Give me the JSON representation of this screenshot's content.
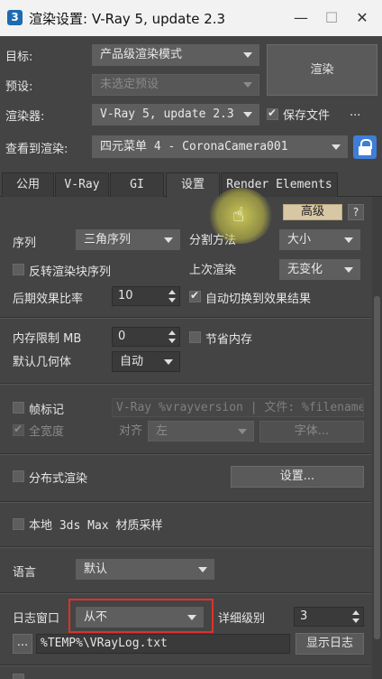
{
  "window": {
    "title": "渲染设置: V-Ray 5, update 2.3",
    "app_icon_glyph": "3"
  },
  "top": {
    "target_label": "目标:",
    "target_value": "产品级渲染模式",
    "preset_label": "预设:",
    "preset_value": "未选定预设",
    "renderer_label": "渲染器:",
    "renderer_value": "V-Ray 5, update 2.3",
    "save_file_label": "保存文件",
    "save_file_checked": true,
    "more_label": "...",
    "render_button": "渲染",
    "view_label": "查看到渲染:",
    "view_value": "四元菜单 4 - CoronaCamera001"
  },
  "tabs": [
    {
      "label": "公用",
      "active": false
    },
    {
      "label": "V-Ray",
      "active": false
    },
    {
      "label": "GI",
      "active": false
    },
    {
      "label": "设置",
      "active": true
    },
    {
      "label": "Render Elements",
      "active": false
    }
  ],
  "panel": {
    "advanced_button": "高级",
    "help_button": "?",
    "sequence_label": "序列",
    "sequence_value": "三角序列",
    "division_label": "分割方法",
    "division_value": "大小",
    "reverse_label": "反转渲染块序列",
    "reverse_checked": false,
    "last_render_label": "上次渲染",
    "last_render_value": "无变化",
    "post_ratio_label": "后期效果比率",
    "post_ratio_value": "10",
    "auto_switch_label": "自动切换到效果结果",
    "auto_switch_checked": true,
    "mem_limit_label": "内存限制 MB",
    "mem_limit_value": "0",
    "save_mem_label": "节省内存",
    "save_mem_checked": false,
    "default_geo_label": "默认几何体",
    "default_geo_value": "自动",
    "frame_stamp_label": "帧标记",
    "frame_stamp_checked": false,
    "frame_stamp_text": "V-Ray %vrayversion | 文件: %filename",
    "full_width_label": "全宽度",
    "full_width_checked": true,
    "align_label": "对齐",
    "align_value": "左",
    "font_button": "字体...",
    "distributed_label": "分布式渲染",
    "distributed_checked": false,
    "settings_button": "设置...",
    "local_3ds_label": "本地 3ds Max 材质采样",
    "local_3ds_checked": false,
    "language_label": "语言",
    "language_value": "默认",
    "log_window_label": "日志窗口",
    "log_window_value": "从不",
    "verbosity_label": "详细级别",
    "verbosity_value": "3",
    "log_browse_button": "...",
    "log_path": "%TEMP%\\VRayLog.txt",
    "show_log_button": "显示日志"
  },
  "colors": {
    "highlight_box": "#e0302b",
    "lock_button": "#3f7ed6",
    "cursor_halo": "#d8d45a"
  }
}
